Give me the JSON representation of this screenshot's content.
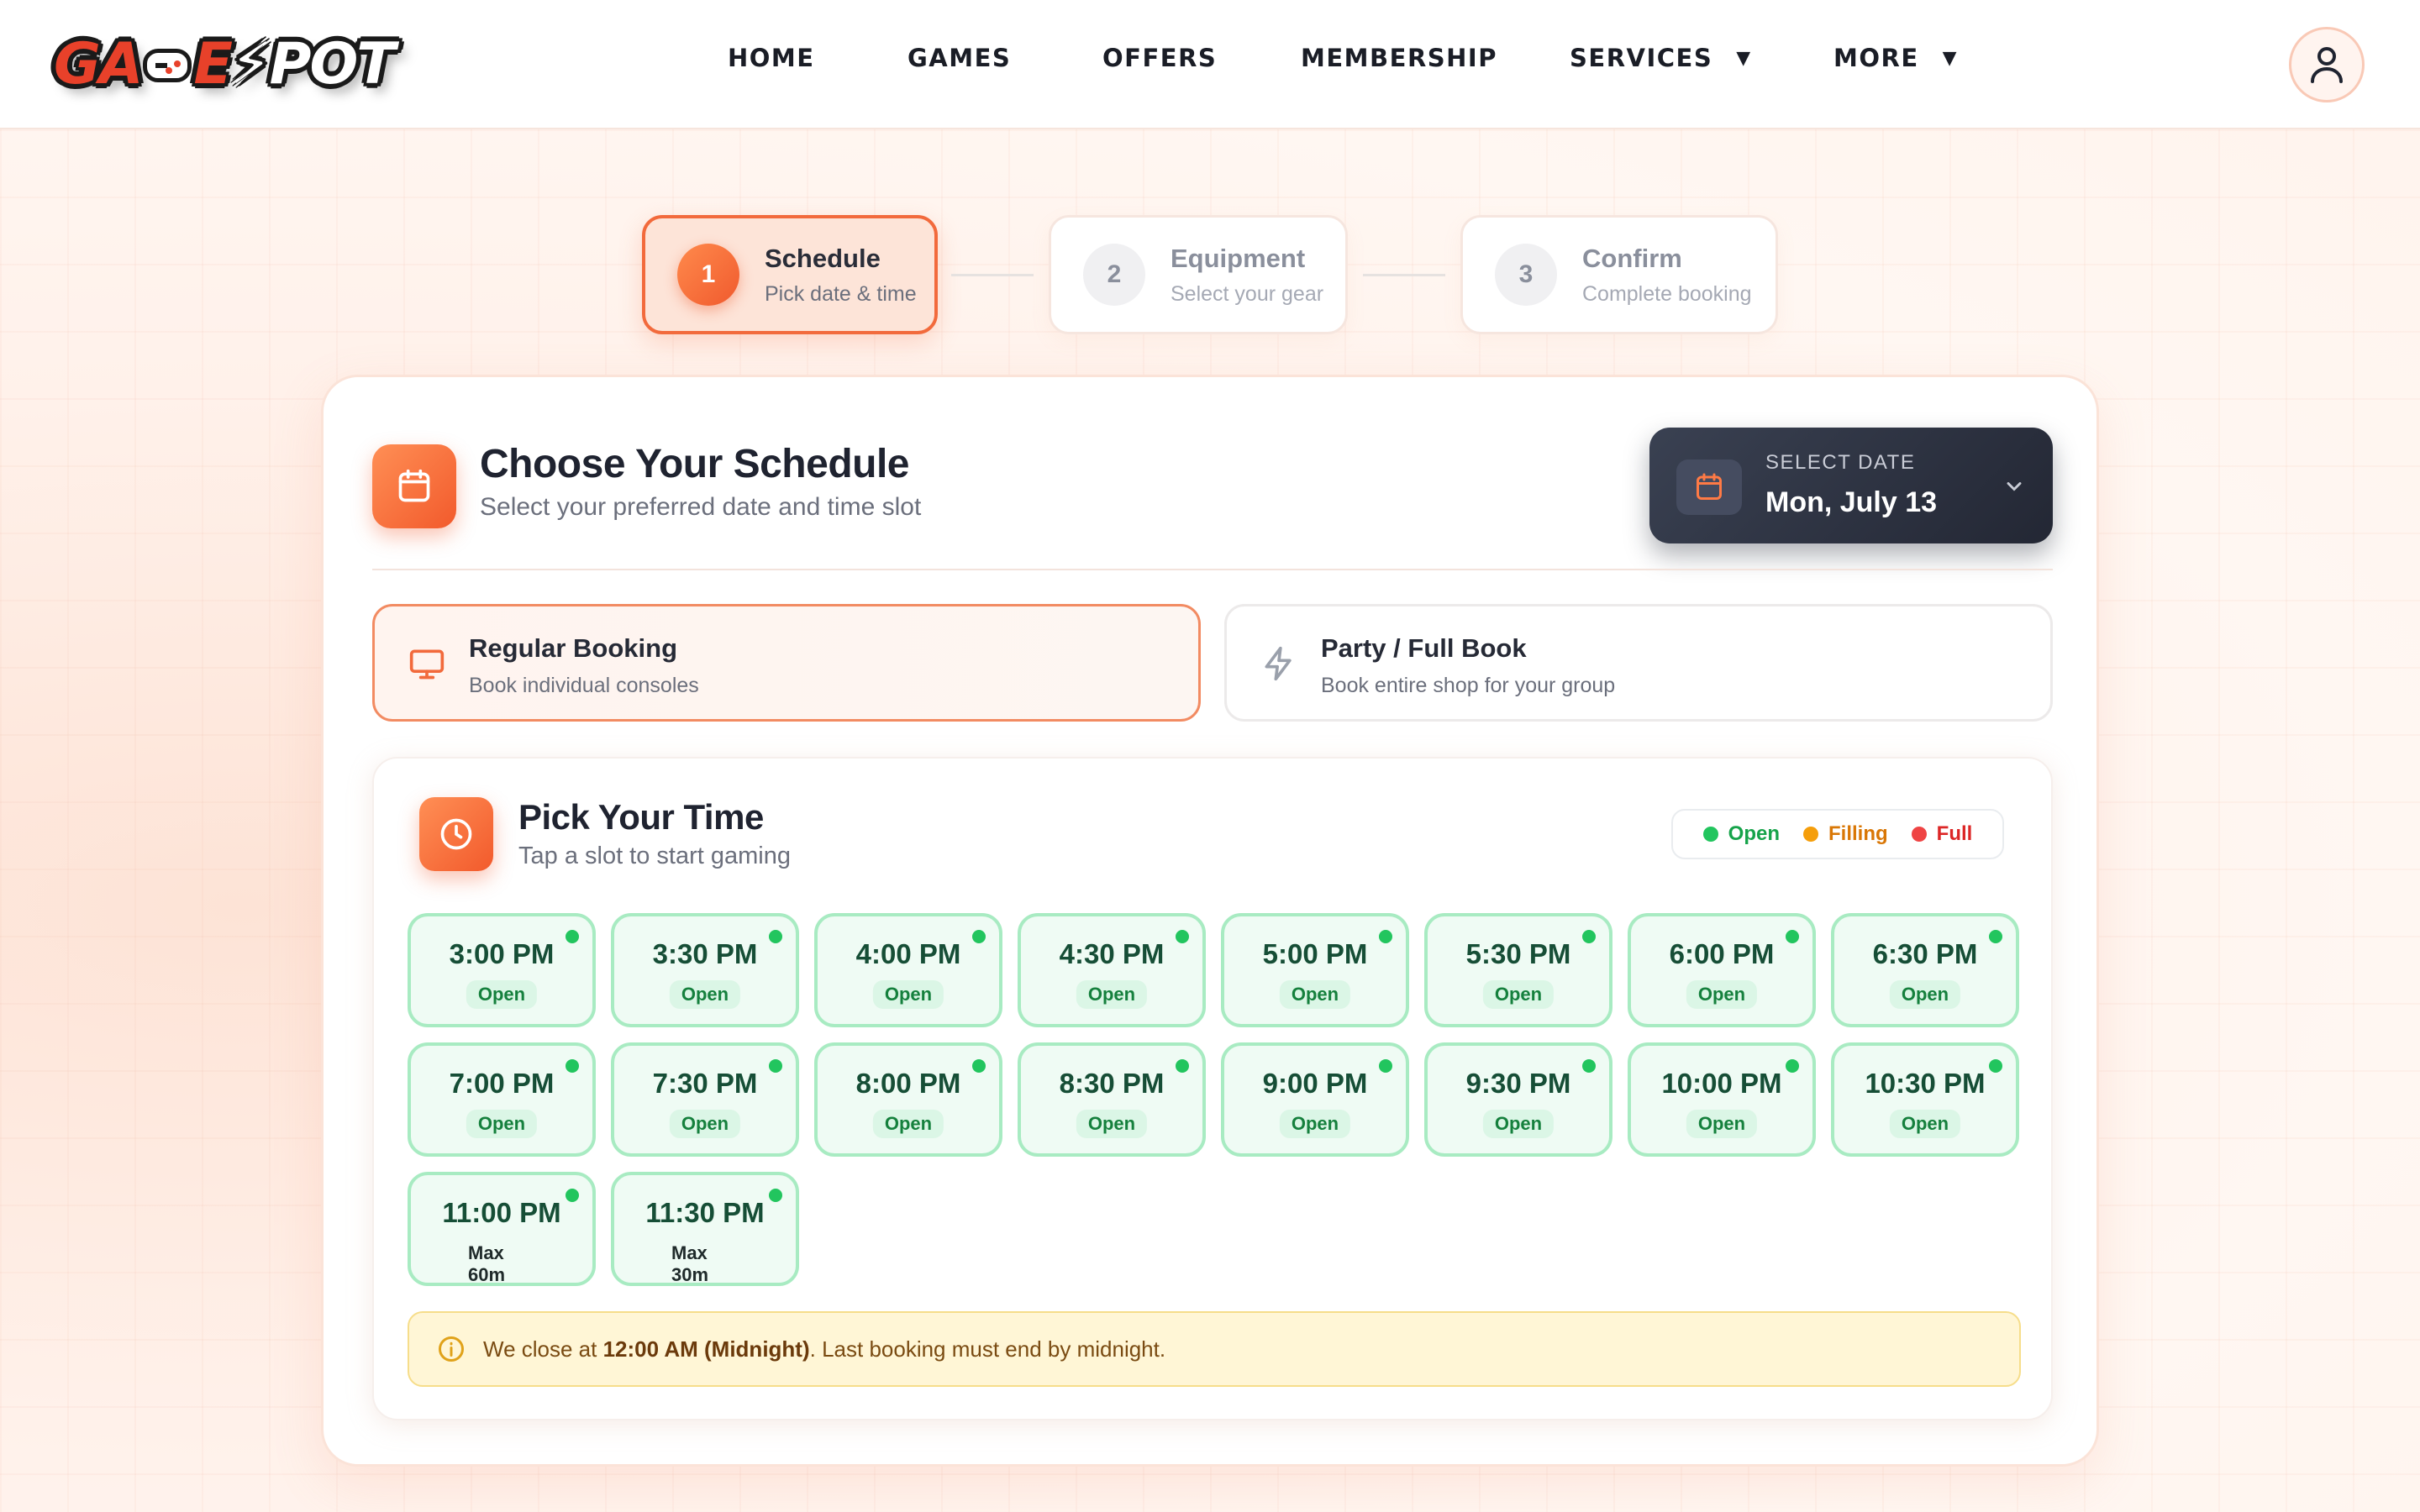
{
  "brand": {
    "logo_text_a": "GA",
    "logo_text_b": "E",
    "logo_text_c": "POT"
  },
  "nav": {
    "items": [
      {
        "label": "HOME",
        "dropdown": false
      },
      {
        "label": "GAMES",
        "dropdown": false
      },
      {
        "label": "OFFERS",
        "dropdown": false
      },
      {
        "label": "MEMBERSHIP",
        "dropdown": false
      },
      {
        "label": "SERVICES",
        "dropdown": true
      },
      {
        "label": "MORE",
        "dropdown": true
      }
    ],
    "caret": "▼",
    "user_icon": "user-icon"
  },
  "stepper": {
    "steps": [
      {
        "num": "1",
        "title": "Schedule",
        "subtitle": "Pick date & time",
        "active": true
      },
      {
        "num": "2",
        "title": "Equipment",
        "subtitle": "Select your gear",
        "active": false
      },
      {
        "num": "3",
        "title": "Confirm",
        "subtitle": "Complete booking",
        "active": false
      }
    ]
  },
  "schedule": {
    "title": "Choose Your Schedule",
    "subtitle": "Select your preferred date and time slot",
    "date_label": "SELECT DATE",
    "date_value": "Mon, July 13"
  },
  "booking_types": [
    {
      "title": "Regular Booking",
      "subtitle": "Book individual consoles",
      "icon": "monitor-icon",
      "active": true
    },
    {
      "title": "Party / Full Book",
      "subtitle": "Book entire shop for your group",
      "icon": "lightning-icon",
      "active": false
    }
  ],
  "time_picker": {
    "title": "Pick Your Time",
    "subtitle": "Tap a slot to start gaming",
    "legend": [
      {
        "label": "Open",
        "color": "#22c55e",
        "text_color": "#16a34a"
      },
      {
        "label": "Filling",
        "color": "#f59e0b",
        "text_color": "#d97706"
      },
      {
        "label": "Full",
        "color": "#ef4444",
        "text_color": "#dc2626"
      }
    ],
    "slots": [
      {
        "time": "3:00 PM",
        "status": "Open"
      },
      {
        "time": "3:30 PM",
        "status": "Open"
      },
      {
        "time": "4:00 PM",
        "status": "Open"
      },
      {
        "time": "4:30 PM",
        "status": "Open"
      },
      {
        "time": "5:00 PM",
        "status": "Open"
      },
      {
        "time": "5:30 PM",
        "status": "Open"
      },
      {
        "time": "6:00 PM",
        "status": "Open"
      },
      {
        "time": "6:30 PM",
        "status": "Open"
      },
      {
        "time": "7:00 PM",
        "status": "Open"
      },
      {
        "time": "7:30 PM",
        "status": "Open"
      },
      {
        "time": "8:00 PM",
        "status": "Open"
      },
      {
        "time": "8:30 PM",
        "status": "Open"
      },
      {
        "time": "9:00 PM",
        "status": "Open"
      },
      {
        "time": "9:30 PM",
        "status": "Open"
      },
      {
        "time": "10:00 PM",
        "status": "Open"
      },
      {
        "time": "10:30 PM",
        "status": "Open"
      },
      {
        "time": "11:00 PM",
        "status": "Max 60m"
      },
      {
        "time": "11:30 PM",
        "status": "Max 30m"
      }
    ],
    "notice": {
      "prefix": "We close at ",
      "highlight": "12:00 AM (Midnight)",
      "suffix": ". Last booking must end by midnight."
    }
  },
  "colors": {
    "accent": "#f26a3c",
    "open": "#22c55e",
    "dark_panel": "#2a2f3d"
  }
}
